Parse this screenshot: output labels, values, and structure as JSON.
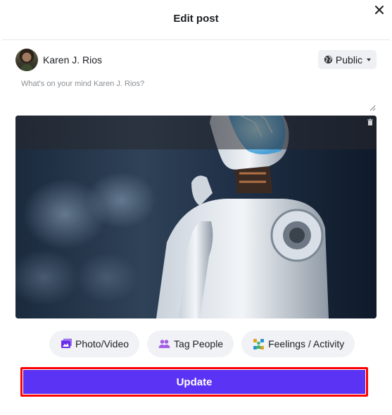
{
  "dialog": {
    "title": "Edit post",
    "close_icon": "close-icon"
  },
  "author": {
    "name": "Karen J. Rios"
  },
  "privacy": {
    "label": "Public",
    "icon": "globe-icon"
  },
  "composer": {
    "placeholder": "What's on your mind Karen J. Rios?",
    "value": ""
  },
  "attachment": {
    "remove_icon": "trash-icon"
  },
  "actions": [
    {
      "label": "Photo/Video",
      "icon": "photo-icon",
      "color": "#6a2ee8"
    },
    {
      "label": "Tag People",
      "icon": "people-icon",
      "color": "#a45ee5"
    },
    {
      "label": "Feelings / Activity",
      "icon": "feelings-icon",
      "color": "#2a8fd6"
    }
  ],
  "submit": {
    "label": "Update",
    "color": "#5b33f5",
    "highlight_color": "#ff0000"
  }
}
